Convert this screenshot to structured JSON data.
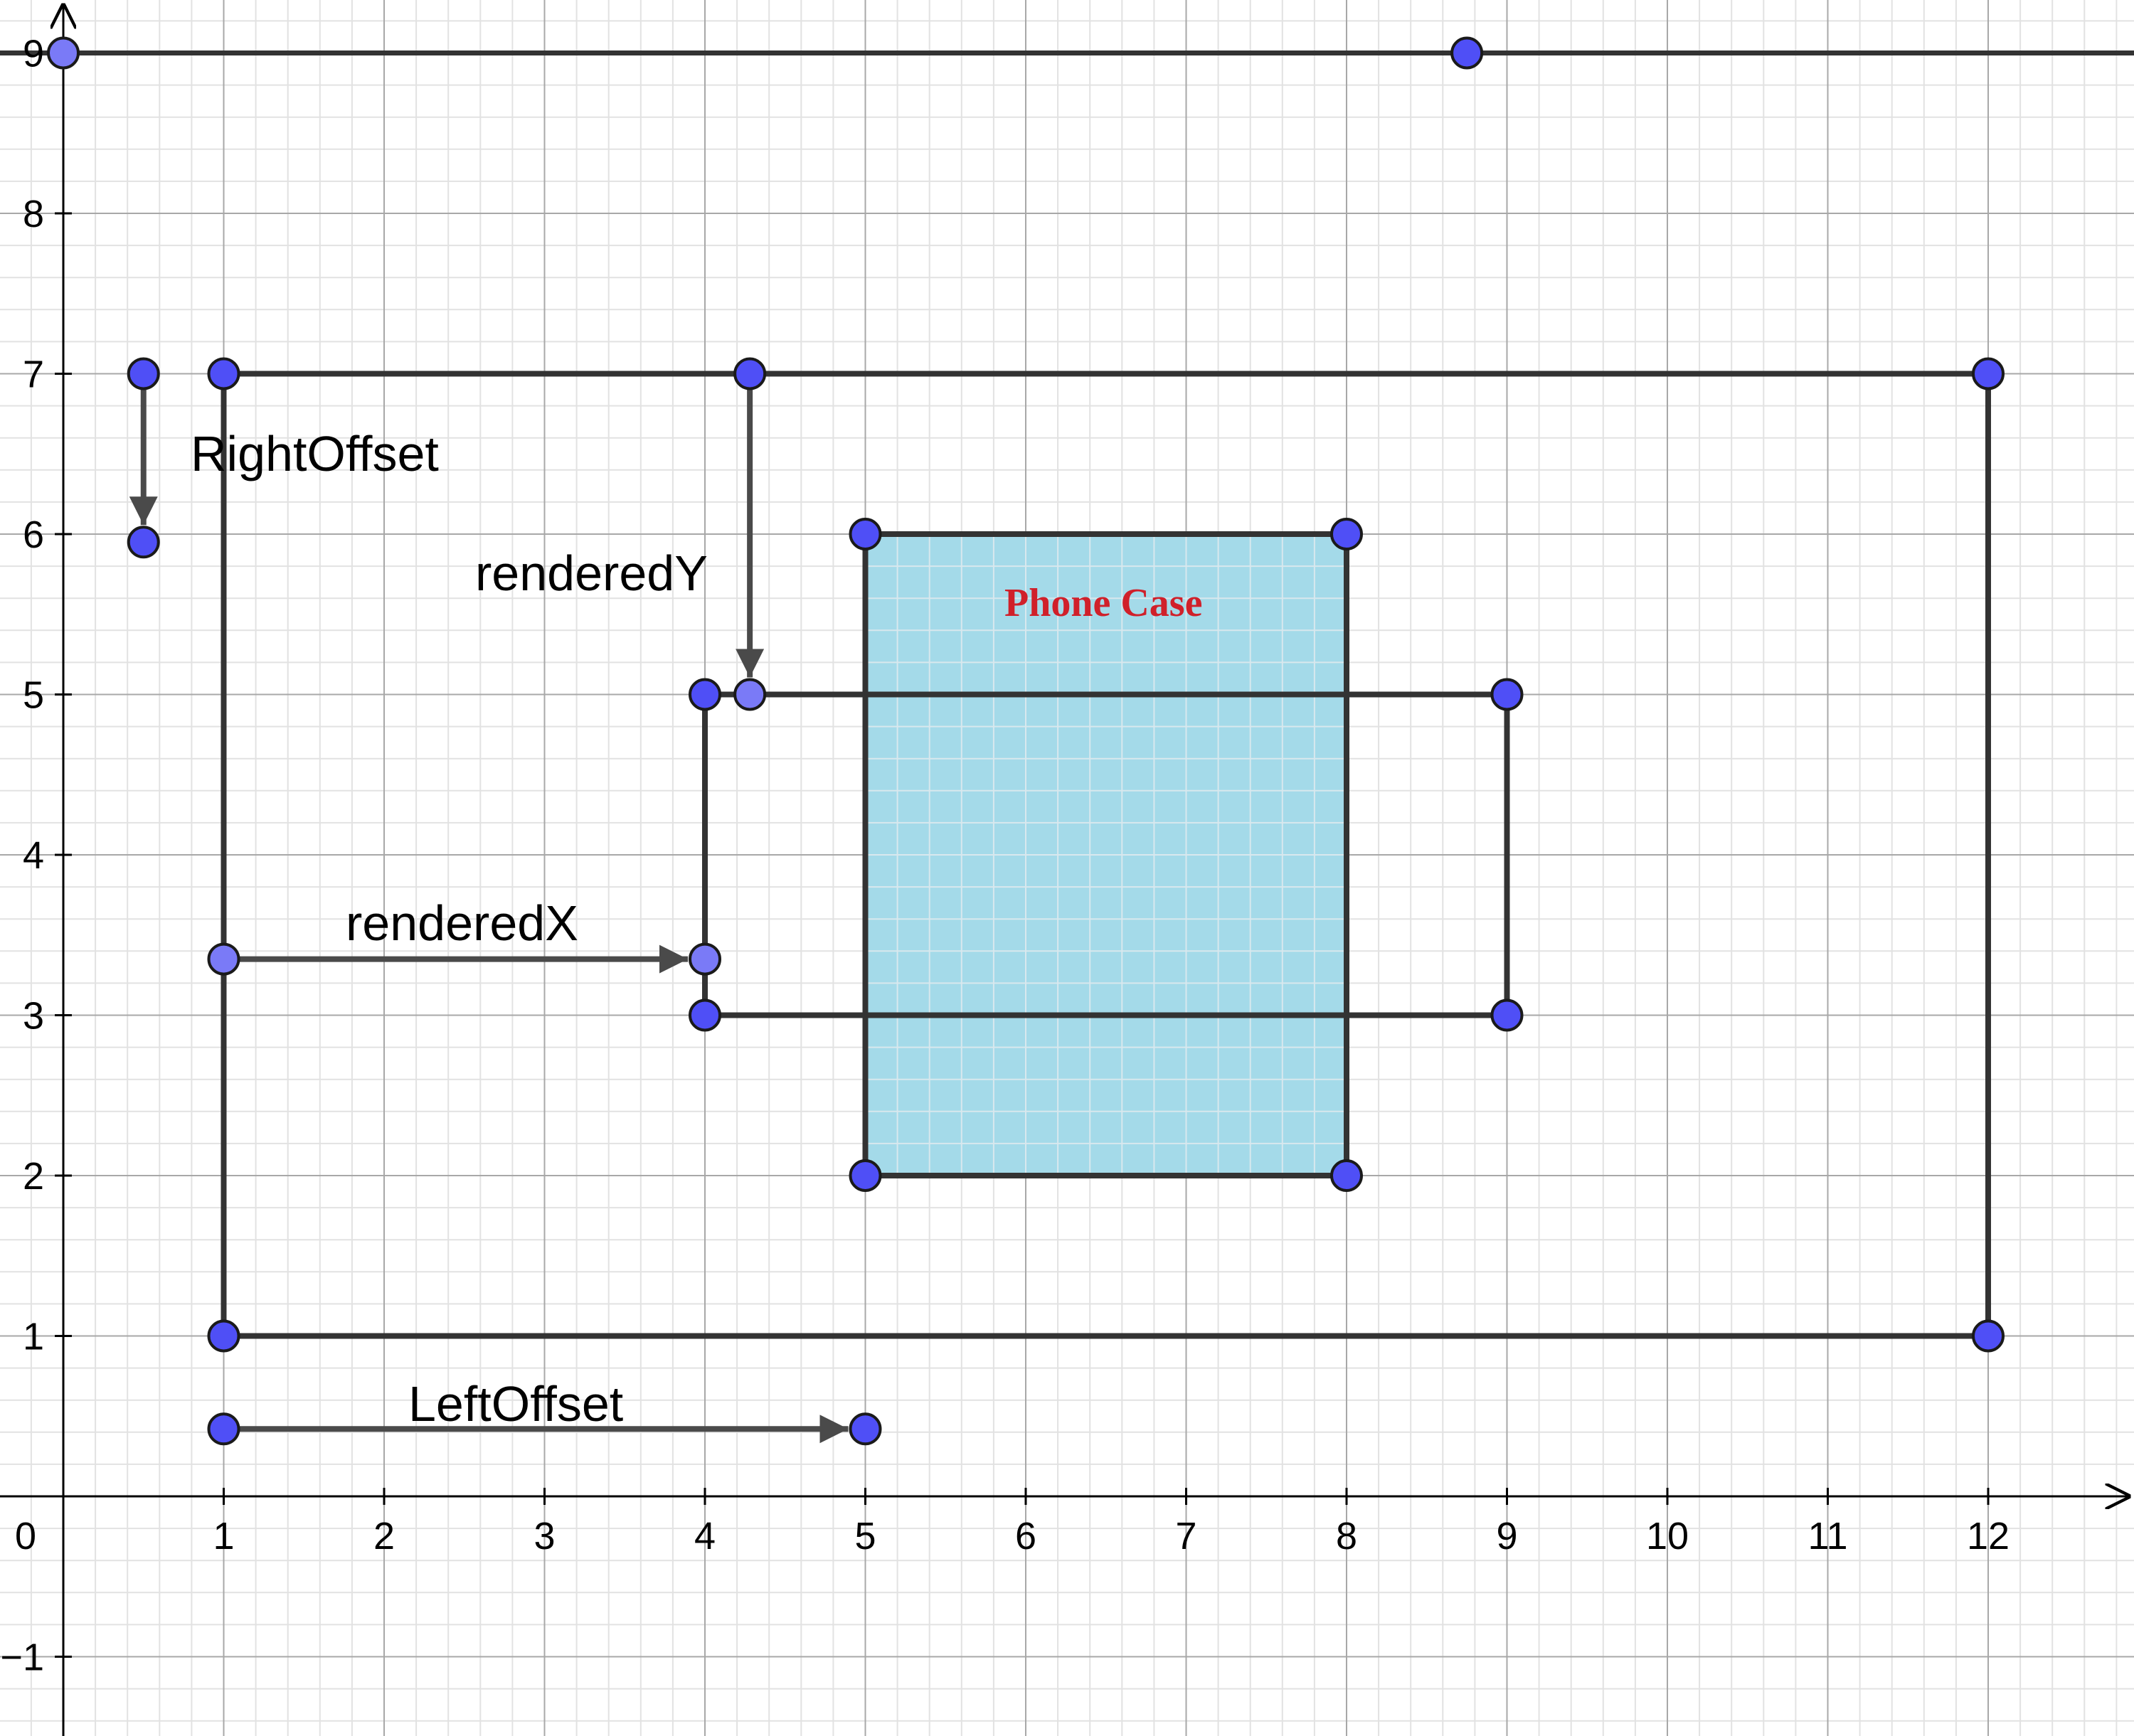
{
  "axes": {
    "x_ticks": [
      "0",
      "1",
      "2",
      "3",
      "4",
      "5",
      "6",
      "7",
      "8",
      "9",
      "10",
      "11",
      "12"
    ],
    "y_ticks": [
      "−1",
      "1",
      "2",
      "3",
      "4",
      "5",
      "6",
      "7",
      "8",
      "9"
    ]
  },
  "colors": {
    "point": "#4f4ff6",
    "point_light": "#7a7af7",
    "shape_fill": "#9fd8e8",
    "stroke": "#333333",
    "title": "#d0202a"
  },
  "shapes": {
    "outer_rect": {
      "x1": 1,
      "y1": 1,
      "x2": 12,
      "y2": 7
    },
    "phone_case": {
      "x1": 5,
      "y1": 2,
      "x2": 8,
      "y2": 6
    },
    "inner_rect": {
      "x1": 4,
      "y1": 3,
      "x2": 9,
      "y2": 5
    },
    "top_line_y": 9
  },
  "points": [
    {
      "x": 0,
      "y": 9,
      "light": true
    },
    {
      "x": 8.75,
      "y": 9,
      "light": false
    },
    {
      "x": 0.5,
      "y": 7,
      "light": false
    },
    {
      "x": 0.5,
      "y": 5.95,
      "light": false
    },
    {
      "x": 1,
      "y": 7,
      "light": false
    },
    {
      "x": 4.28,
      "y": 7,
      "light": false
    },
    {
      "x": 12,
      "y": 7,
      "light": false
    },
    {
      "x": 5,
      "y": 6,
      "light": false
    },
    {
      "x": 8,
      "y": 6,
      "light": false
    },
    {
      "x": 4,
      "y": 5,
      "light": false
    },
    {
      "x": 4.28,
      "y": 5,
      "light": true
    },
    {
      "x": 9,
      "y": 5,
      "light": false
    },
    {
      "x": 1,
      "y": 3.35,
      "light": true
    },
    {
      "x": 4,
      "y": 3.35,
      "light": true
    },
    {
      "x": 4,
      "y": 3,
      "light": false
    },
    {
      "x": 9,
      "y": 3,
      "light": false
    },
    {
      "x": 5,
      "y": 2,
      "light": false
    },
    {
      "x": 8,
      "y": 2,
      "light": false
    },
    {
      "x": 1,
      "y": 1,
      "light": false
    },
    {
      "x": 12,
      "y": 1,
      "light": false
    },
    {
      "x": 1,
      "y": 0.42,
      "light": false
    },
    {
      "x": 5,
      "y": 0.42,
      "light": false
    }
  ],
  "vectors": [
    {
      "name": "vector-right-offset",
      "from": [
        0.5,
        7
      ],
      "to": [
        0.5,
        5.95
      ]
    },
    {
      "name": "vector-rendered-y",
      "from": [
        4.28,
        7
      ],
      "to": [
        4.28,
        5
      ]
    },
    {
      "name": "vector-rendered-x",
      "from": [
        1,
        3.35
      ],
      "to": [
        4,
        3.35
      ]
    },
    {
      "name": "vector-left-offset",
      "from": [
        1,
        0.42
      ],
      "to": [
        5,
        0.42
      ]
    }
  ],
  "labels": {
    "right_offset": "RightOffset",
    "rendered_y": "renderedY",
    "rendered_x": "renderedX",
    "left_offset": "LeftOffset",
    "phone_case": "Phone Case"
  }
}
